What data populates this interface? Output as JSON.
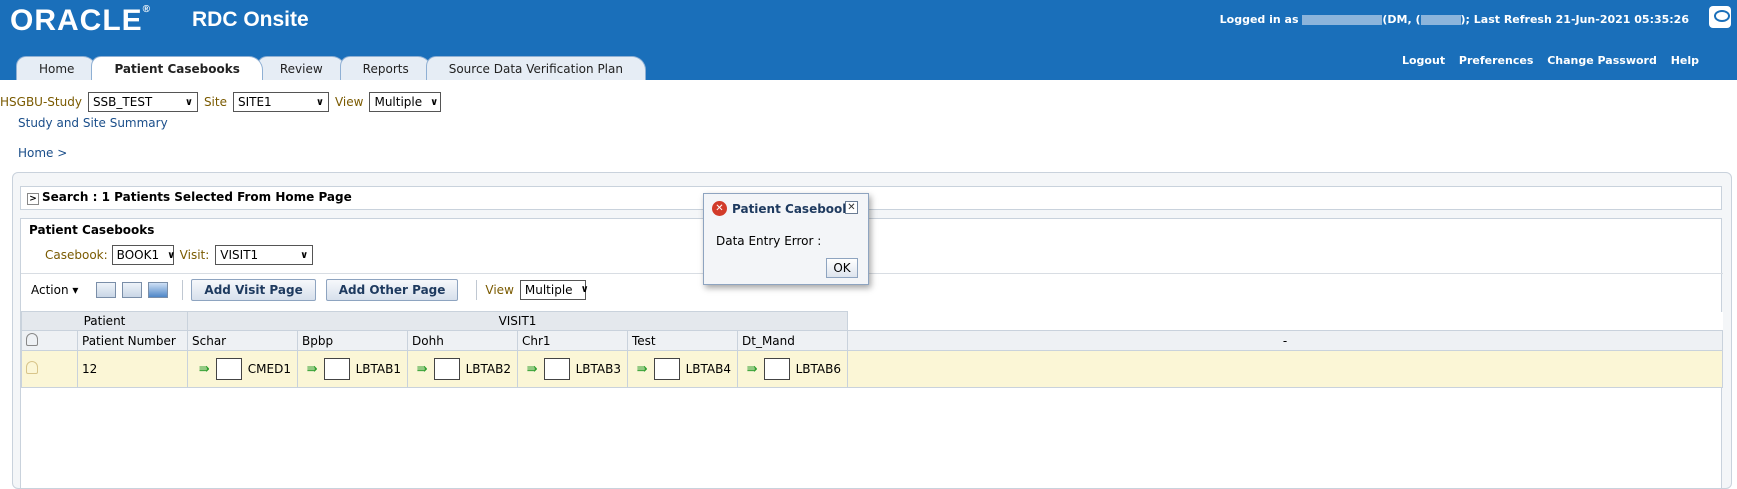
{
  "header": {
    "logo": "ORACLE",
    "product": "RDC Onsite",
    "login_prefix": "Logged in as",
    "login_mid1": "(DM, (",
    "login_mid2": "); Last Refresh 21-Jun-2021 05:35:26",
    "links": [
      "Logout",
      "Preferences",
      "Change Password",
      "Help"
    ]
  },
  "tabs": [
    "Home",
    "Patient Casebooks",
    "Review",
    "Reports",
    "Source Data Verification Plan"
  ],
  "study_bar": {
    "study_label": "HSGBU-Study",
    "study_value": "SSB_TEST",
    "site_label": "Site",
    "site_value": "SITE1",
    "view_label": "View",
    "view_value": "Multiple",
    "summary_link": "Study and Site Summary"
  },
  "breadcrumb": "Home >",
  "search": {
    "label": "Search : 1 Patients Selected From Home Page"
  },
  "panel": {
    "title": "Patient Casebooks",
    "casebook_label": "Casebook:",
    "casebook_value": "BOOK1",
    "visit_label": "Visit:",
    "visit_value": "VISIT1"
  },
  "toolbar": {
    "action_label": "Action ▾",
    "add_visit_page": "Add Visit Page",
    "add_other_page": "Add Other Page",
    "view_label": "View",
    "view_value": "Multiple"
  },
  "table": {
    "group_patient": "Patient",
    "group_visit": "VISIT1",
    "col_patient_number": "Patient Number",
    "columns": [
      "Schar",
      "Bpbp",
      "Dohh",
      "Chr1",
      "Test",
      "Dt_Mand"
    ],
    "dash": "-",
    "row": {
      "patient_number": "12",
      "pages": [
        "CMED1",
        "LBTAB1",
        "LBTAB2",
        "LBTAB3",
        "LBTAB4",
        "LBTAB6"
      ]
    }
  },
  "dialog": {
    "title": "Patient Casebooks",
    "message": "Data Entry Error :",
    "ok_label": "OK"
  },
  "colors": {
    "header": "#1a6fba",
    "row_highlight": "#fbf6d6",
    "error": "#d23b2a"
  }
}
